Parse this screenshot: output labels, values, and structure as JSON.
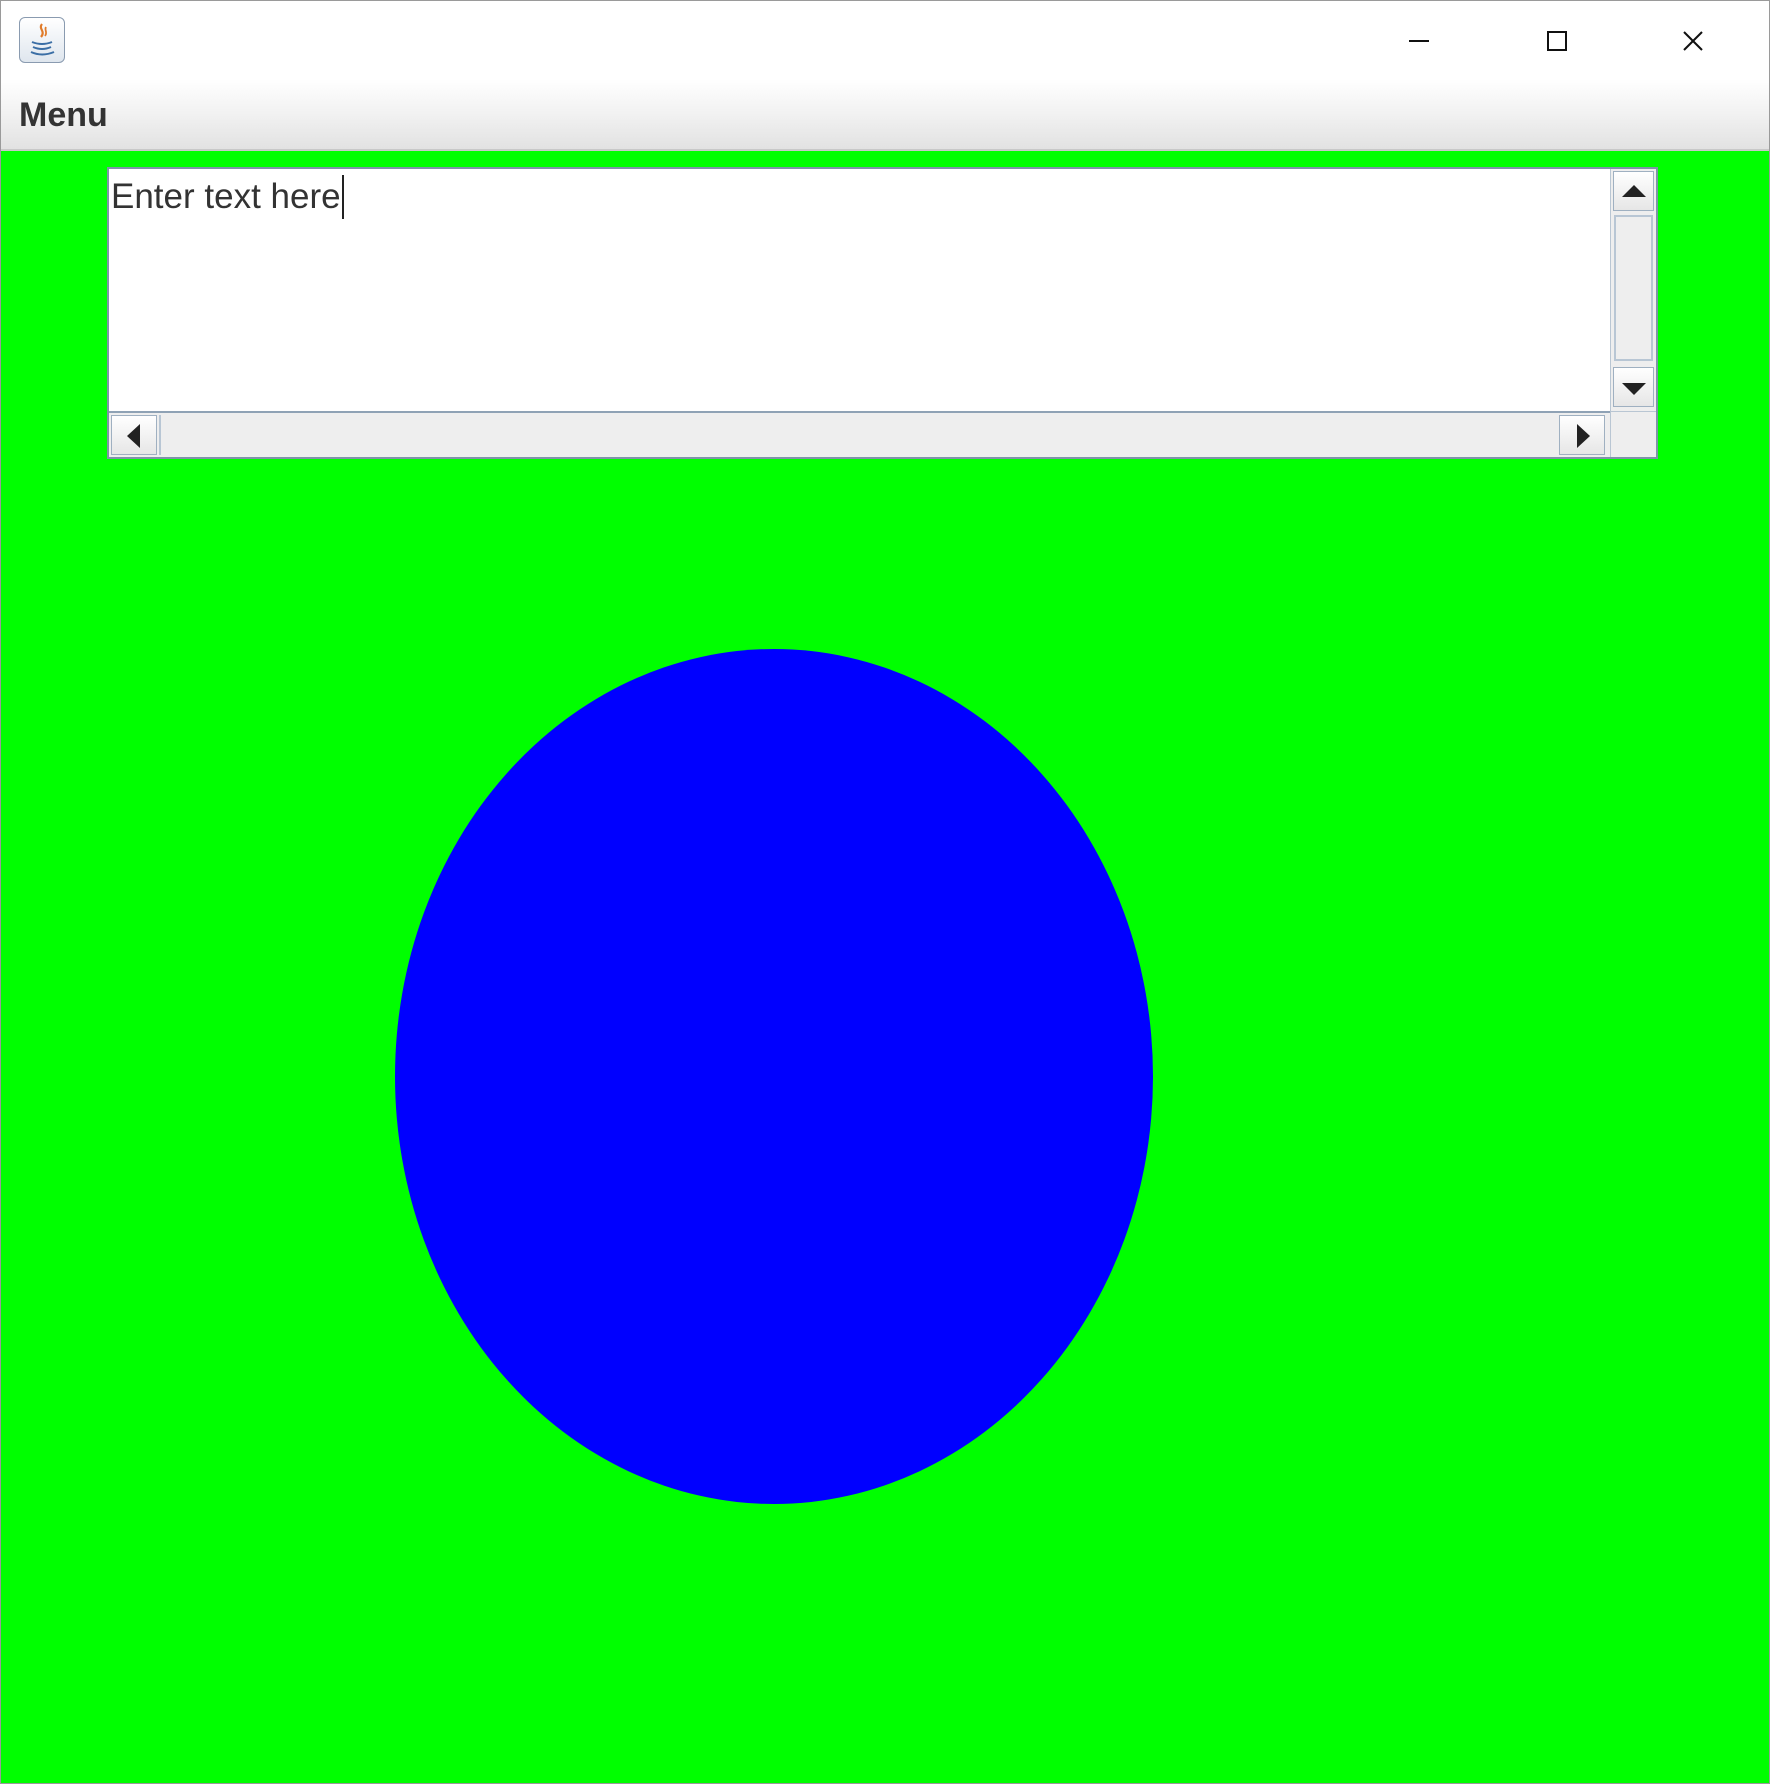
{
  "window": {
    "icon": "java-coffee-icon",
    "controls": [
      "minimize-icon",
      "maximize-icon",
      "close-icon"
    ]
  },
  "menubar": {
    "items": [
      {
        "label": "Menu"
      }
    ]
  },
  "text_area": {
    "value": "Enter text here"
  },
  "canvas": {
    "background_color": "#00ff00",
    "shape": "ellipse",
    "shape_color": "#0000ff"
  }
}
